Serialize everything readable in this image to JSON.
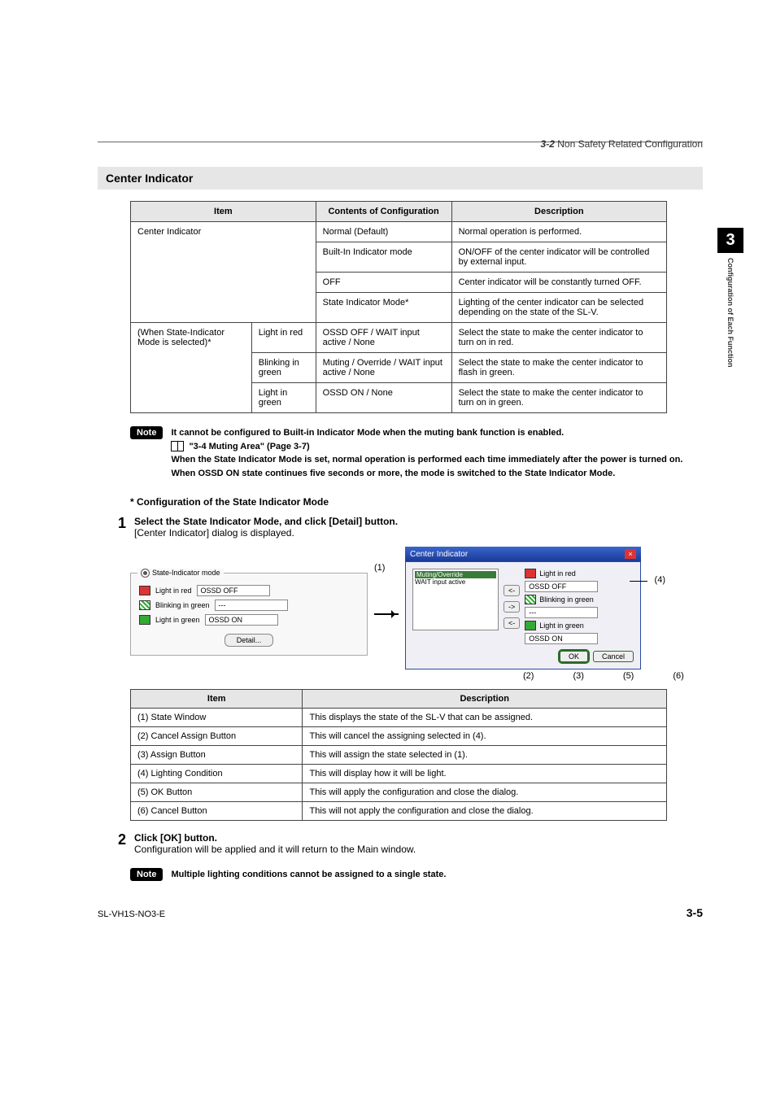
{
  "header": {
    "sec": "3-2",
    "title": " Non Safety Related Configuration"
  },
  "sidetab": {
    "num": "3",
    "label": "Configuration of Each Function"
  },
  "section_title": "Center Indicator",
  "t1": {
    "head": [
      "Item",
      "Contents of Configuration",
      "Description"
    ],
    "rows": [
      {
        "item": "Center Indicator",
        "sub": "",
        "conf": "Normal (Default)",
        "desc": "Normal operation is performed."
      },
      {
        "item": "",
        "sub": "",
        "conf": "Built-In Indicator mode",
        "desc": "ON/OFF of the center indicator will be controlled by external input."
      },
      {
        "item": "",
        "sub": "",
        "conf": "OFF",
        "desc": "Center indicator will be constantly turned OFF."
      },
      {
        "item": "",
        "sub": "",
        "conf": "State Indicator Mode*",
        "desc": "Lighting of the center indicator can be selected depending on the state of the SL-V."
      },
      {
        "item": "(When State-Indicator Mode is selected)*",
        "sub": "Light in red",
        "conf": "OSSD OFF / WAIT input active / None",
        "desc": "Select the state to make the center indicator to turn on in red."
      },
      {
        "item": "",
        "sub": "Blinking in green",
        "conf": "Muting / Override / WAIT input active / None",
        "desc": "Select the state to make the center indicator to flash in green."
      },
      {
        "item": "",
        "sub": "Light in green",
        "conf": "OSSD ON / None",
        "desc": "Select the state to make the center indicator to turn on in green."
      }
    ]
  },
  "note1": {
    "label": "Note",
    "line1": "It cannot be configured  to Built-in Indicator Mode when the muting bank function is enabled.",
    "ref": "\"3-4 Muting Area\" (Page 3-7)",
    "line2": "When the State Indicator Mode is set, normal operation is performed each time immediately after the power is turned on. When OSSD ON state continues five seconds or more, the mode is switched to the State Indicator Mode."
  },
  "subhead": "* Configuration of the State Indicator Mode",
  "step1": {
    "num": "1",
    "bold": "Select the State Indicator Mode, and click [Detail] button.",
    "plain": "[Center Indicator] dialog is displayed."
  },
  "panel_left": {
    "mode": "State-Indicator mode",
    "rows": [
      {
        "label": "Light in red",
        "value": "OSSD OFF"
      },
      {
        "label": "Blinking in green",
        "value": "---"
      },
      {
        "label": "Light in green",
        "value": "OSSD ON"
      }
    ],
    "detail_btn": "Detail..."
  },
  "panel_right": {
    "title": "Center Indicator",
    "list": [
      "Muting/Override",
      "WAIT input active"
    ],
    "btn_left": "<-",
    "btn_right": "->",
    "cond": [
      {
        "label": "Light in red",
        "value": "OSSD OFF"
      },
      {
        "label": "Blinking in green",
        "value": "---"
      },
      {
        "label": "Light in green",
        "value": "OSSD ON"
      }
    ],
    "ok": "OK",
    "cancel": "Cancel"
  },
  "callouts": {
    "c1": "(1)",
    "c2": "(2)",
    "c3": "(3)",
    "c4": "(4)",
    "c5": "(5)",
    "c6": "(6)"
  },
  "t2": {
    "head": [
      "Item",
      "Description"
    ],
    "rows": [
      [
        "(1) State Window",
        "This displays the state of the SL-V that can be assigned."
      ],
      [
        "(2) Cancel Assign Button",
        "This will cancel the assigning selected in (4)."
      ],
      [
        "(3) Assign Button",
        "This will assign the state selected in (1)."
      ],
      [
        "(4) Lighting Condition",
        "This will display how it will be light."
      ],
      [
        "(5) OK Button",
        "This will apply the configuration and close the dialog."
      ],
      [
        "(6) Cancel Button",
        "This will not apply the configuration and close the dialog."
      ]
    ]
  },
  "step2": {
    "num": "2",
    "bold": "Click [OK] button.",
    "plain": "Configuration will be applied and it will return to the Main window."
  },
  "note2": {
    "label": "Note",
    "text": "Multiple lighting conditions cannot be assigned to a single state."
  },
  "footer": {
    "doc": "SL-VH1S-NO3-E",
    "page": "3-5"
  }
}
